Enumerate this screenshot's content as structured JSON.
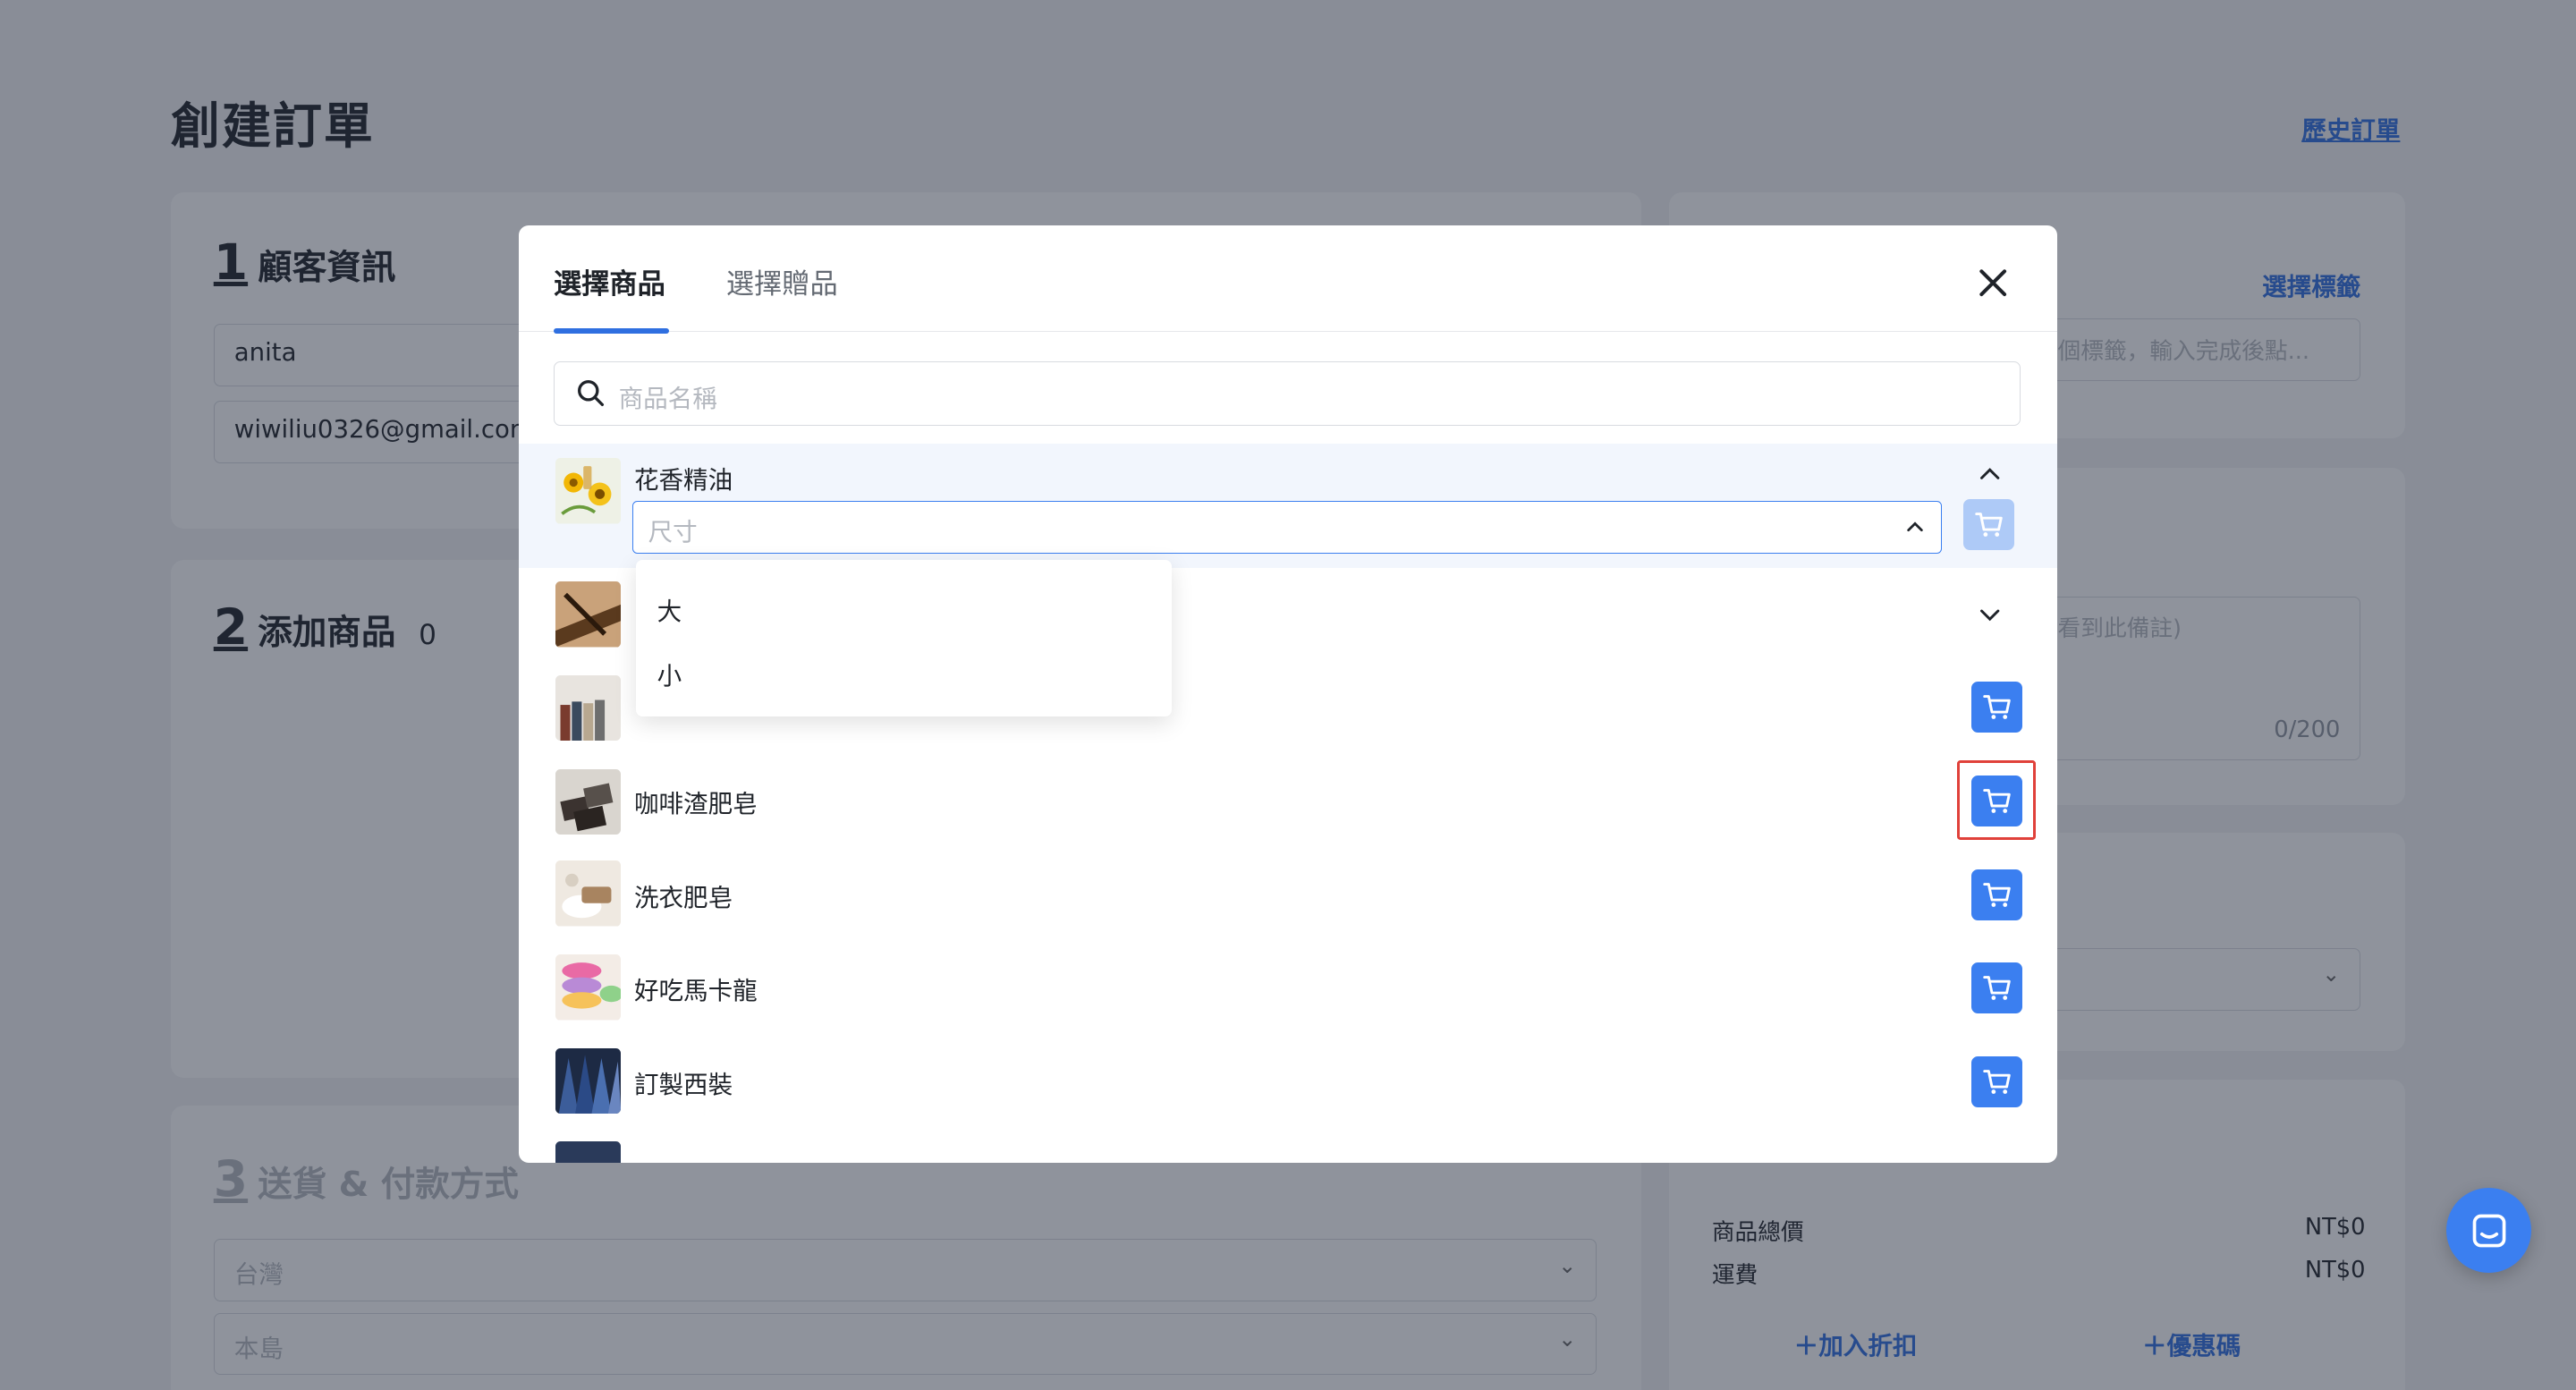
{
  "page": {
    "title": "創建訂單",
    "history_link": "歷史訂單"
  },
  "customer": {
    "step": "1",
    "title": "顧客資訊",
    "name_value": "anita",
    "email_value": "wiwiliu0326@gmail.com"
  },
  "products_section": {
    "step": "2",
    "title": "添加商品",
    "count": "0"
  },
  "shipping": {
    "step": "3",
    "title": "送貨 & 付款方式",
    "country_value": "台灣",
    "region_value": "本島"
  },
  "tags": {
    "select_link": "選擇標籤",
    "input_placeholder": "個標籤，輸入完成後點..."
  },
  "notes": {
    "placeholder": "看到此備註)",
    "counter": "0/200"
  },
  "summary": {
    "subtotal_label": "商品總價",
    "subtotal_value": "NT$0",
    "shipping_label": "運費",
    "shipping_value": "NT$0",
    "add_discount": "加入折扣",
    "coupon": "優惠碼"
  },
  "modal": {
    "tab_products": "選擇商品",
    "tab_gifts": "選擇贈品",
    "search_placeholder": "商品名稱",
    "products": [
      {
        "name": "花香精油",
        "expanded": true,
        "size_placeholder": "尺寸"
      },
      {
        "name": "",
        "expanded": false
      },
      {
        "name": "",
        "expanded": false
      },
      {
        "name": "咖啡渣肥皂"
      },
      {
        "name": "洗衣肥皂"
      },
      {
        "name": "好吃馬卡龍"
      },
      {
        "name": "訂製西裝"
      }
    ],
    "size_options": [
      "大",
      "小"
    ]
  },
  "colors": {
    "primary": "#3b7ff0",
    "primary_disabled": "#aecaf7",
    "highlight": "#e0413a"
  }
}
